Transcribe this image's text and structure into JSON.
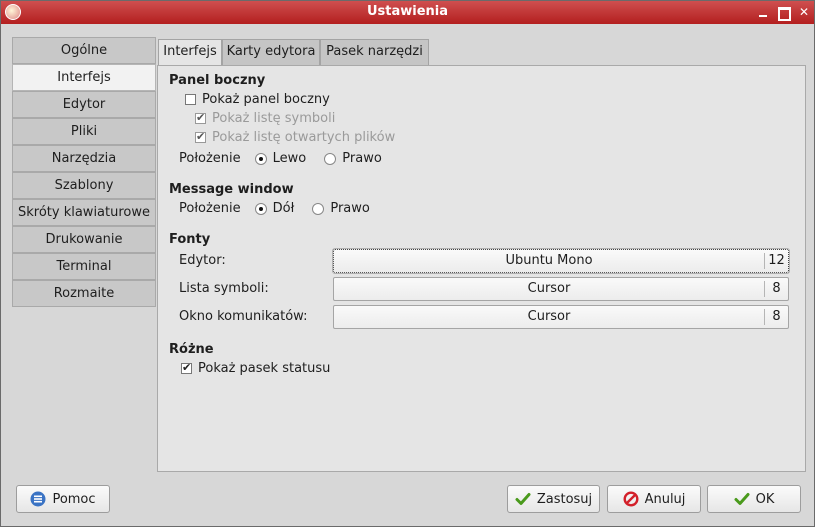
{
  "window": {
    "title": "Ustawienia"
  },
  "sidebar": {
    "items": [
      {
        "label": "Ogólne"
      },
      {
        "label": "Interfejs"
      },
      {
        "label": "Edytor"
      },
      {
        "label": "Pliki"
      },
      {
        "label": "Narzędzia"
      },
      {
        "label": "Szablony"
      },
      {
        "label": "Skróty klawiaturowe"
      },
      {
        "label": "Drukowanie"
      },
      {
        "label": "Terminal"
      },
      {
        "label": "Rozmaite"
      }
    ],
    "selected": "Interfejs"
  },
  "tabs": [
    {
      "label": "Interfejs"
    },
    {
      "label": "Karty edytora"
    },
    {
      "label": "Pasek narzędzi"
    }
  ],
  "panel": {
    "sidebar_section": {
      "title": "Panel boczny",
      "show_sidebar": {
        "label": "Pokaż panel boczny",
        "checked": false
      },
      "show_symbols": {
        "label": "Pokaż listę symboli",
        "checked": true
      },
      "show_open_files": {
        "label": "Pokaż listę otwartych plików",
        "checked": true
      },
      "position_label": "Położenie",
      "left_label": "Lewo",
      "right_label": "Prawo",
      "position_value": "Lewo"
    },
    "message_section": {
      "title": "Message window",
      "position_label": "Położenie",
      "bottom_label": "Dół",
      "right_label": "Prawo",
      "position_value": "Dół"
    },
    "fonts_section": {
      "title": "Fonty",
      "editor": {
        "label": "Edytor:",
        "font": "Ubuntu Mono",
        "size": "12"
      },
      "symbols": {
        "label": "Lista symboli:",
        "font": "Cursor",
        "size": "8"
      },
      "messages": {
        "label": "Okno komunikatów:",
        "font": "Cursor",
        "size": "8"
      }
    },
    "misc_section": {
      "title": "Różne",
      "show_statusbar": {
        "label": "Pokaż pasek statusu",
        "checked": true
      }
    }
  },
  "buttons": {
    "help": "Pomoc",
    "apply": "Zastosuj",
    "cancel": "Anuluj",
    "ok": "OK"
  },
  "colors": {
    "titlebar": "#b31f1f",
    "apply_icon": "#4a9a1c",
    "cancel_icon": "#d3202a",
    "help_icon": "#3a73c4"
  }
}
